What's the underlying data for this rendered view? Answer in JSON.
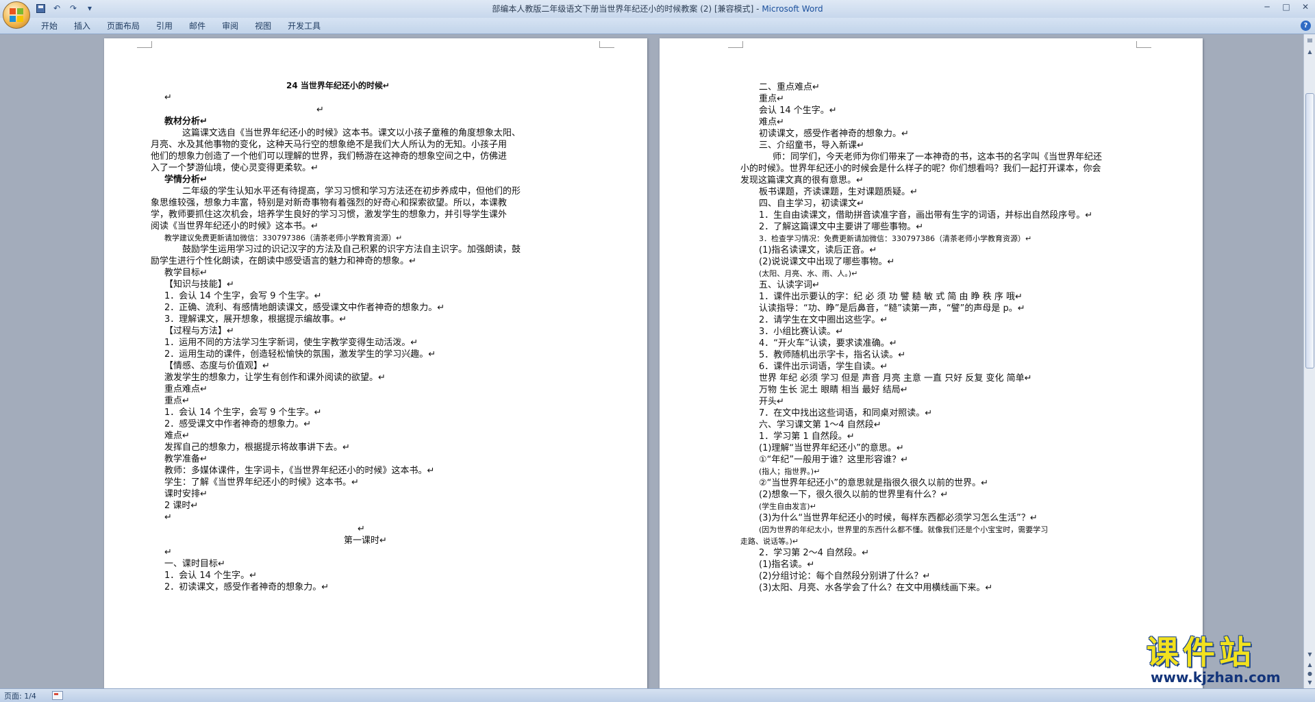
{
  "window": {
    "title": "部编本人教版二年级语文下册当世界年纪还小的时候教案 (2) [兼容模式] - ",
    "app": "Microsoft Word"
  },
  "qat": [
    "save-icon",
    "undo-icon",
    "redo-icon",
    "customize-icon"
  ],
  "ribbon": {
    "tabs": [
      "开始",
      "插入",
      "页面布局",
      "引用",
      "邮件",
      "审阅",
      "视图",
      "开发工具"
    ]
  },
  "status": {
    "page": "页面: 1/4"
  },
  "watermark": {
    "title": "课件站",
    "url": "www.kjzhan.com"
  },
  "left_page": {
    "lines": [
      "24  当世界年纪还小的时候↵",
      "↵",
      "↵",
      "教材分析↵",
      "这篇课文选自《当世界年纪还小的时候》这本书。课文以小孩子童稚的角度想象太阳、",
      "月亮、水及其他事物的变化，这种天马行空的想象绝不是我们大人所认为的无知。小孩子用",
      "他们的想象力创造了一个他们可以理解的世界，我们畅游在这神奇的想象空间之中，仿佛进",
      "入了一个梦游仙境，使心灵变得更柔软。↵",
      "学情分析↵",
      "二年级的学生认知水平还有待提高，学习习惯和学习方法还在初步养成中，但他们的形",
      "象思维较强，想象力丰富，特别是对新奇事物有着强烈的好奇心和探索欲望。所以，本课教",
      "学，教师要抓住这次机会，培养学生良好的学习习惯，激发学生的想象力，并引导学生课外",
      "阅读《当世界年纪还小的时候》这本书。↵",
      "教学建议免费更新请加微信：330797386（清茶老师小学教育资源）↵",
      "鼓励学生运用学习过的识记汉字的方法及自己积累的识字方法自主识字。加强朗读，鼓",
      "励学生进行个性化朗读，在朗读中感受语言的魅力和神奇的想象。↵",
      "教学目标↵",
      "【知识与技能】↵",
      "1．会认 14 个生字，会写 9 个生字。↵",
      "2．正确、流利、有感情地朗读课文，感受课文中作者神奇的想象力。↵",
      "3．理解课文，展开想象，根据提示编故事。↵",
      "【过程与方法】↵",
      "1．运用不同的方法学习生字新词，使生字教学变得生动活泼。↵",
      "2．运用生动的课件，创造轻松愉快的氛围，激发学生的学习兴趣。↵",
      "【情感、态度与价值观】↵",
      "激发学生的想象力，让学生有创作和课外阅读的欲望。↵",
      "重点难点↵",
      "重点↵",
      "1．会认 14 个生字，会写 9 个生字。↵",
      "2．感受课文中作者神奇的想象力。↵",
      "难点↵",
      "发挥自己的想象力，根据提示将故事讲下去。↵",
      "教学准备↵",
      "教师：多媒体课件，生字词卡，《当世界年纪还小的时候》这本书。↵",
      "学生：了解《当世界年纪还小的时候》这本书。↵",
      "课时安排↵",
      "2 课时↵",
      "↵",
      "↵",
      "第一课时↵",
      "↵",
      "一、课时目标↵",
      "1．会认 14 个生字。↵",
      "2．初读课文，感受作者神奇的想象力。↵"
    ]
  },
  "right_page": {
    "lines": [
      "二、重点难点↵",
      "重点↵",
      "会认 14 个生字。↵",
      "难点↵",
      "初读课文，感受作者神奇的想象力。↵",
      "三、介绍童书，导入新课↵",
      "师：同学们，今天老师为你们带来了一本神奇的书，这本书的名字叫《当世界年纪还",
      "小的时候》。世界年纪还小的时候会是什么样子的呢？你们想看吗？我们一起打开课本，你会",
      "发现这篇课文真的很有意思。↵",
      "板书课题，齐读课题，生对课题质疑。↵",
      "四、自主学习，初读课文↵",
      "1．生自由读课文，借助拼音读准字音，画出带有生字的词语，并标出自然段序号。↵",
      "2．了解这篇课文中主要讲了哪些事物。↵",
      "3．检查学习情况：免费更新请加微信：330797386（清茶老师小学教育资源）↵",
      "(1)指名读课文，读后正音。↵",
      "(2)说说课文中出现了哪些事物。↵",
      "(太阳、月亮、水、雨、人。)↵",
      "五、认读字词↵",
      "1．课件出示要认的字：纪  必  须  功  譬  糙  敏  式  简  由  睁  秩  序  哦↵",
      "认读指导：“功、睁”是后鼻音，“糙”读第一声，“譬”的声母是 p。↵",
      "2．请学生在文中圈出这些字。↵",
      "3．小组比赛认读。↵",
      "4．“开火车”认读，要求读准确。↵",
      "5．教师随机出示字卡，指名认读。↵",
      "6．课件出示词语，学生自读。↵",
      "世界  年纪  必须  学习  但是  声音  月亮  主意  一直  只好  反复  变化  简单↵",
      "万物  生长  泥土  眼睛  相当  最好  结局↵",
      "开头↵",
      "7．在文中找出这些词语，和同桌对照读。↵",
      "六、学习课文第 1～4 自然段↵",
      "1．学习第 1 自然段。↵",
      "(1)理解“当世界年纪还小”的意思。↵",
      "①“年纪”一般用于谁？这里形容谁？↵",
      "(指人；指世界。)↵",
      "②“当世界年纪还小”的意思就是指很久很久以前的世界。↵",
      "(2)想象一下，很久很久以前的世界里有什么？↵",
      "(学生自由发言)↵",
      "(3)为什么“当世界年纪还小的时候，每样东西都必须学习怎么生活”？↵",
      "(因为世界的年纪太小，世界里的东西什么都不懂。就像我们还是个小宝宝时，需要学习",
      "走路、说话等。)↵",
      "2．学习第 2～4 自然段。↵",
      "(1)指名读。↵",
      "(2)分组讨论：每个自然段分别讲了什么？↵",
      "(3)太阳、月亮、水各学会了什么？在文中用横线画下来。↵"
    ]
  }
}
